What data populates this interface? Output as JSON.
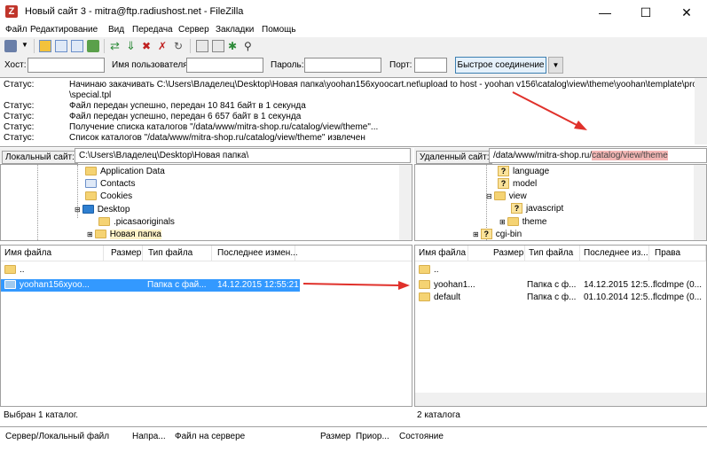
{
  "window": {
    "title": "Новый сайт 3 - mitra@ftp.radiushost.net - FileZilla",
    "app_icon": "Z",
    "minimize": "—",
    "maximize": "☐",
    "close": "✕"
  },
  "menu": [
    "Файл",
    "Редактирование",
    "Вид",
    "Передача",
    "Сервер",
    "Закладки",
    "Помощь"
  ],
  "quickconnect": {
    "host_label": "Хост:",
    "user_label": "Имя пользователя",
    "pass_label": "Пароль:",
    "port_label": "Порт:",
    "host_value": "",
    "user_value": "",
    "pass_value": "",
    "port_value": "",
    "button_label": "Быстрое соединение",
    "dropdown": "▼"
  },
  "log": [
    {
      "label": "Статус:",
      "message": "Начинаю закачивать C:\\Users\\Владелец\\Desktop\\Новая папка\\yoohan156xyoocart.net\\upload to host - yoohan v156\\catalog\\view\\theme\\yoohan\\template\\product"
    },
    {
      "label": "",
      "message": "\\special.tpl"
    },
    {
      "label": "Статус:",
      "message": "Файл передан успешно, передан 10 841 байт в 1 секунда"
    },
    {
      "label": "Статус:",
      "message": "Файл передан успешно, передан 6 657 байт в 1 секунда"
    },
    {
      "label": "Статус:",
      "message": "Получение списка каталогов \"/data/www/mitra-shop.ru/catalog/view/theme\"..."
    },
    {
      "label": "Статус:",
      "message": "Список каталогов \"/data/www/mitra-shop.ru/catalog/view/theme\" извлечен"
    }
  ],
  "local": {
    "site_label": "Локальный сайт:",
    "site_path": "C:\\Users\\Владелец\\Desktop\\Новая папка\\",
    "tree": [
      "Application Data",
      "Contacts",
      "Cookies",
      "Desktop",
      ".picasaoriginals",
      "Новая папка"
    ],
    "columns": [
      "Имя файла",
      "Размер",
      "Тип файла",
      "Последнее измен..."
    ],
    "rows": [
      {
        "name": "..",
        "size": "",
        "type": "",
        "modified": ""
      },
      {
        "name": "yoohan156xyoo...",
        "size": "",
        "type": "Папка с фай...",
        "modified": "14.12.2015 12:55:21"
      }
    ],
    "status": "Выбран 1 каталог."
  },
  "remote": {
    "site_label": "Удаленный сайт:",
    "site_path_prefix": "/data/www/mitra-shop.ru/",
    "site_path_highlight": "catalog/view/theme",
    "tree": [
      "language",
      "model",
      "view",
      "javascript",
      "theme",
      "cgi-bin"
    ],
    "columns": [
      "Имя файла",
      "Размер",
      "Тип файла",
      "Последнее из...",
      "Права"
    ],
    "rows": [
      {
        "name": "..",
        "size": "",
        "type": "",
        "modified": "",
        "perms": ""
      },
      {
        "name": "yoohan1...",
        "size": "",
        "type": "Папка с ф...",
        "modified": "14.12.2015 12:5...",
        "perms": "flcdmpe (0..."
      },
      {
        "name": "default",
        "size": "",
        "type": "Папка с ф...",
        "modified": "01.10.2014 12:5...",
        "perms": "flcdmpe (0..."
      }
    ],
    "status": "2 каталога"
  },
  "queue": {
    "columns": [
      "Сервер/Локальный файл",
      "Напра...",
      "Файл на сервере",
      "Размер",
      "Приор...",
      "Состояние"
    ]
  },
  "colors": {
    "selection": "#3399ff",
    "annotation_red": "#e0312b",
    "folder": "#f5d373"
  }
}
